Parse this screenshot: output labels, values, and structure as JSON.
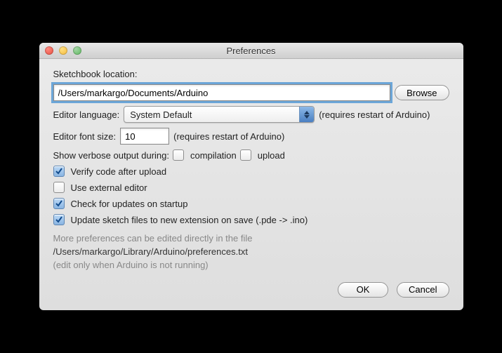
{
  "window": {
    "title": "Preferences"
  },
  "sketchbook": {
    "label": "Sketchbook location:",
    "value": "/Users/markargo/Documents/Arduino",
    "browse": "Browse"
  },
  "language": {
    "label": "Editor language:",
    "selected": "System Default",
    "hint": "(requires restart of Arduino)"
  },
  "fontsize": {
    "label": "Editor font size:",
    "value": "10",
    "hint": "(requires restart of Arduino)"
  },
  "verbose": {
    "label": "Show verbose output during:",
    "compilation_label": "compilation",
    "upload_label": "upload"
  },
  "checks": {
    "verify": "Verify code after upload",
    "external": "Use external editor",
    "updates": "Check for updates on startup",
    "extension": "Update sketch files to new extension on save (.pde -> .ino)"
  },
  "note": {
    "line1": "More preferences can be edited directly in the file",
    "path": "/Users/markargo/Library/Arduino/preferences.txt",
    "line3": "(edit only when Arduino is not running)"
  },
  "buttons": {
    "ok": "OK",
    "cancel": "Cancel"
  }
}
